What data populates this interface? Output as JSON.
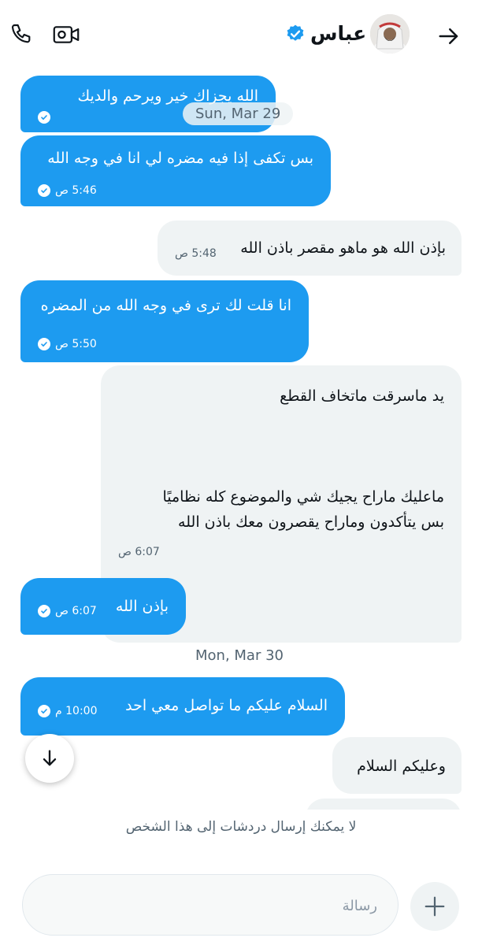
{
  "header": {
    "contact_name": "عباس",
    "verified": true,
    "icons": [
      "back-arrow-icon",
      "video-camera-icon",
      "phone-icon",
      "verified-badge-icon"
    ]
  },
  "chat": {
    "date_pill": "Sun, Mar 29",
    "messages": [
      {
        "direction": "outgoing",
        "text": "الله يجزاك خير ويرحم والديك",
        "time": ""
      },
      {
        "direction": "outgoing",
        "text": "بس تكفى إذا فيه مضره لي انا في وجه الله",
        "time": "5:46 ص"
      },
      {
        "direction": "incoming",
        "text": "بإذن الله هو ماهو مقصر باذن الله",
        "time": "5:48 ص"
      },
      {
        "direction": "outgoing",
        "text": "انا قلت لك ترى في وجه الله من المضره",
        "time": "5:50 ص"
      },
      {
        "direction": "incoming",
        "line1": "يد ماسرقت ماتخاف القطع",
        "line2": "ماعليك ماراح يجيك شي والموضوع كله نظاميًا",
        "line3": "بس يتأكدون وماراح يقصرون معك باذن الله",
        "time": "6:07 ص"
      },
      {
        "direction": "outgoing",
        "text": "بإذن الله",
        "time": "6:07 ص"
      },
      {
        "direction": "outgoing",
        "text": "السلام عليكم ما تواصل معي احد",
        "time": "10:00 م"
      },
      {
        "direction": "incoming",
        "text": "وعليكم السلام",
        "time": ""
      }
    ],
    "date_separator": "Mon, Mar 30"
  },
  "footer": {
    "notice": "لا يمكنك إرسال دردشات إلى هذا الشخص",
    "input_placeholder": "رسالة"
  },
  "colors": {
    "outgoing_bubble": "#1d9bf0",
    "incoming_bubble": "#eff3f4",
    "muted_text": "#536471",
    "verified": "#1d9bf0"
  }
}
